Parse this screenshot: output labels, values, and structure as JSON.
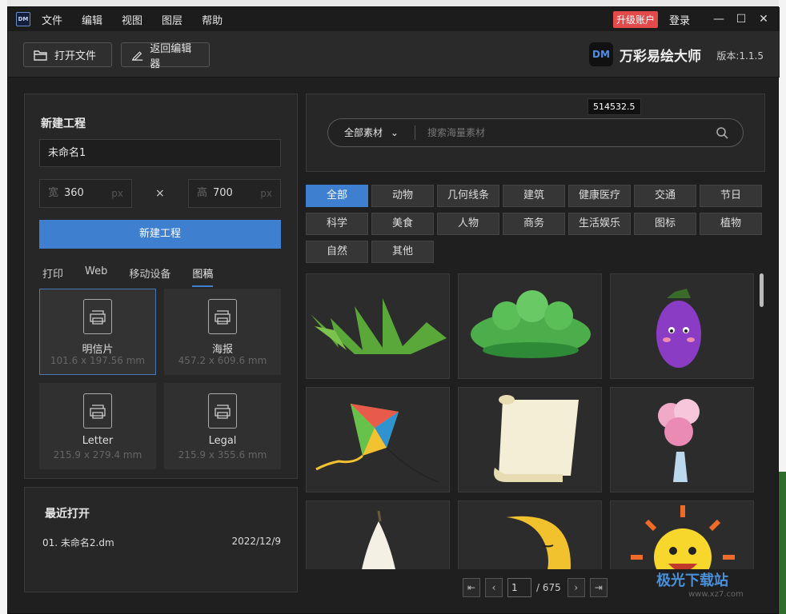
{
  "menu": [
    "文件",
    "编辑",
    "视图",
    "图层",
    "帮助"
  ],
  "app_icon": "DM",
  "title_right": {
    "upgrade": "升级账户",
    "login": "登录"
  },
  "toolbar": {
    "open_label": "打开文件",
    "back_label": "返回编辑器"
  },
  "brand": {
    "logo": "DM",
    "name": "万彩易绘大师",
    "version": "版本:1.1.5"
  },
  "new_project": {
    "title": "新建工程",
    "name_value": "未命名1",
    "width": {
      "label": "宽",
      "value": "360",
      "unit": "px"
    },
    "height": {
      "label": "高",
      "value": "700",
      "unit": "px"
    },
    "times": "×",
    "create_label": "新建工程",
    "tabs": [
      "打印",
      "Web",
      "移动设备",
      "图稿"
    ],
    "active_tab": "图稿",
    "templates": [
      {
        "name": "明信片",
        "size": "101.6 x 197.56 mm",
        "selected": true
      },
      {
        "name": "海报",
        "size": "457.2 x 609.6 mm",
        "selected": false
      },
      {
        "name": "Letter",
        "size": "215.9 x 279.4 mm",
        "selected": false
      },
      {
        "name": "Legal",
        "size": "215.9 x 355.6 mm",
        "selected": false
      }
    ]
  },
  "recent": {
    "title": "最近打开",
    "items": [
      {
        "name": "01. 未命名2.dm",
        "date": "2022/12/9"
      }
    ]
  },
  "search": {
    "category": "全部素材",
    "placeholder": "搜索海量素材",
    "tooltip": "514532.5"
  },
  "categories": [
    "全部",
    "动物",
    "几何线条",
    "建筑",
    "健康医疗",
    "交通",
    "节日",
    "科学",
    "美食",
    "人物",
    "商务",
    "生活娱乐",
    "图标",
    "植物",
    "自然",
    "其他"
  ],
  "active_category": "全部",
  "assets": [
    "grass",
    "bush",
    "eggplant",
    "kite",
    "scroll",
    "flower-vase",
    "pear",
    "moon",
    "sun"
  ],
  "pager": {
    "current": "1",
    "total": "/ 675"
  },
  "watermark": {
    "title": "极光下载站",
    "url": "www.xz7.com"
  }
}
